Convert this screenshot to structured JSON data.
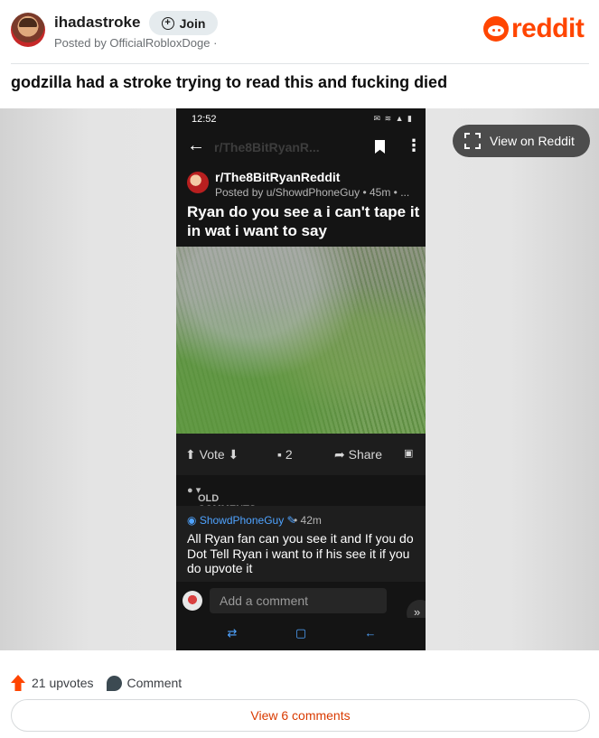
{
  "header": {
    "community": "ihadastroke",
    "posted_by": "Posted by OfficialRobloxDoge ·",
    "join_label": "Join",
    "logo_text": "reddit",
    "brand_color": "#ff4500"
  },
  "post": {
    "title": "godzilla had a stroke trying to read this and fucking died",
    "view_on_reddit_label": "View on Reddit"
  },
  "phone": {
    "status_time": "12:52",
    "status_icons": "✉ ≋ ▲ ▮",
    "appbar_subreddit": "r/The8BitRyanR...",
    "subreddit": "r/The8BitRyanReddit",
    "meta": "Posted by u/ShowdPhoneGuy • 45m • ...",
    "post_title": "Ryan do you see a i can't tape it in wat i want to say",
    "vote_label": "Vote",
    "comment_count": "2",
    "share_label": "Share",
    "sort_label": "OLD COMMENTS",
    "comment": {
      "user": "ShowdPhoneGuy",
      "time": "• 42m",
      "body": "All Ryan fan can you see it and If you do Dot Tell Ryan i want to if his see it if you do upvote it"
    },
    "add_comment_placeholder": "Add a comment"
  },
  "footer": {
    "upvotes": "21 upvotes",
    "comment_label": "Comment",
    "view_comments": "View 6 comments"
  }
}
